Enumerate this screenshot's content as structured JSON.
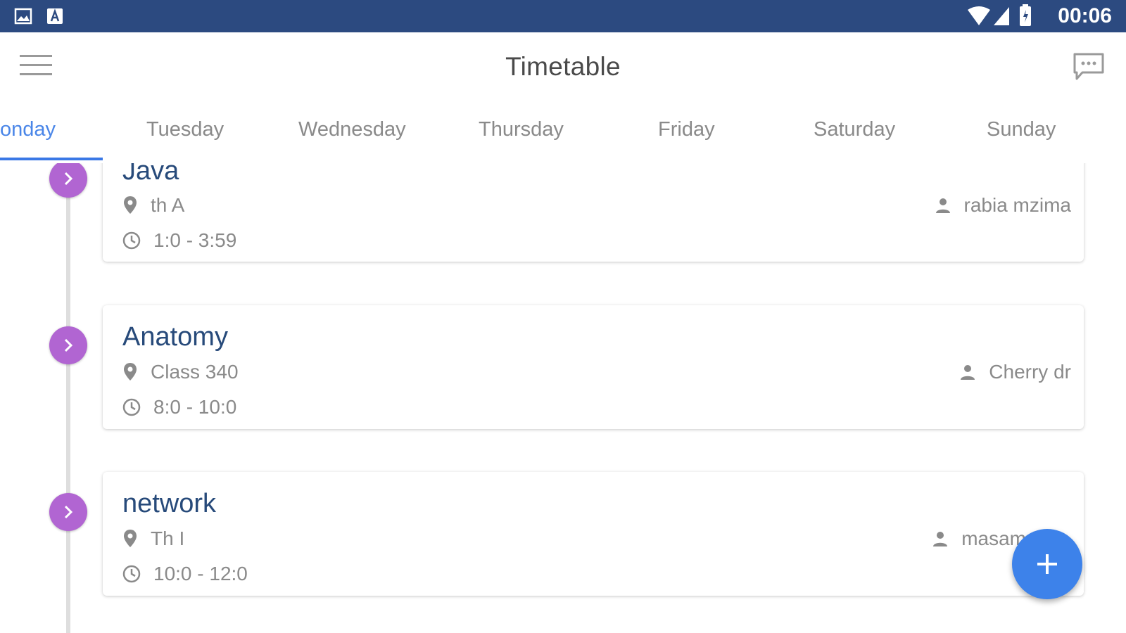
{
  "status_bar": {
    "time": "00:06",
    "left_icons": [
      "image-icon",
      "a-box-icon"
    ],
    "right_icons": [
      "wifi-icon",
      "signal-icon",
      "battery-icon"
    ]
  },
  "app_bar": {
    "title": "Timetable",
    "menu_icon": "hamburger-menu-icon",
    "action_icon": "chat-bubble-icon"
  },
  "tabs": [
    {
      "label": "onday",
      "active": true
    },
    {
      "label": "Tuesday",
      "active": false
    },
    {
      "label": "Wednesday",
      "active": false
    },
    {
      "label": "Thursday",
      "active": false
    },
    {
      "label": "Friday",
      "active": false
    },
    {
      "label": "Saturday",
      "active": false
    },
    {
      "label": "Sunday",
      "active": false
    }
  ],
  "classes": [
    {
      "subject": "Java",
      "room": "th A",
      "time": "1:0 - 3:59",
      "teacher": "rabia mzima"
    },
    {
      "subject": "Anatomy",
      "room": "Class 340",
      "time": "8:0 - 10:0",
      "teacher": "Cherry dr"
    },
    {
      "subject": "network",
      "room": "Th I",
      "time": "10:0 - 12:0",
      "teacher": "masam"
    }
  ],
  "colors": {
    "status_bar": "#2c4a80",
    "accent": "#3a78e6",
    "node": "#b165d2",
    "fab": "#3d82ea",
    "subject_text": "#274a7a"
  },
  "fab": {
    "icon": "plus-icon"
  }
}
